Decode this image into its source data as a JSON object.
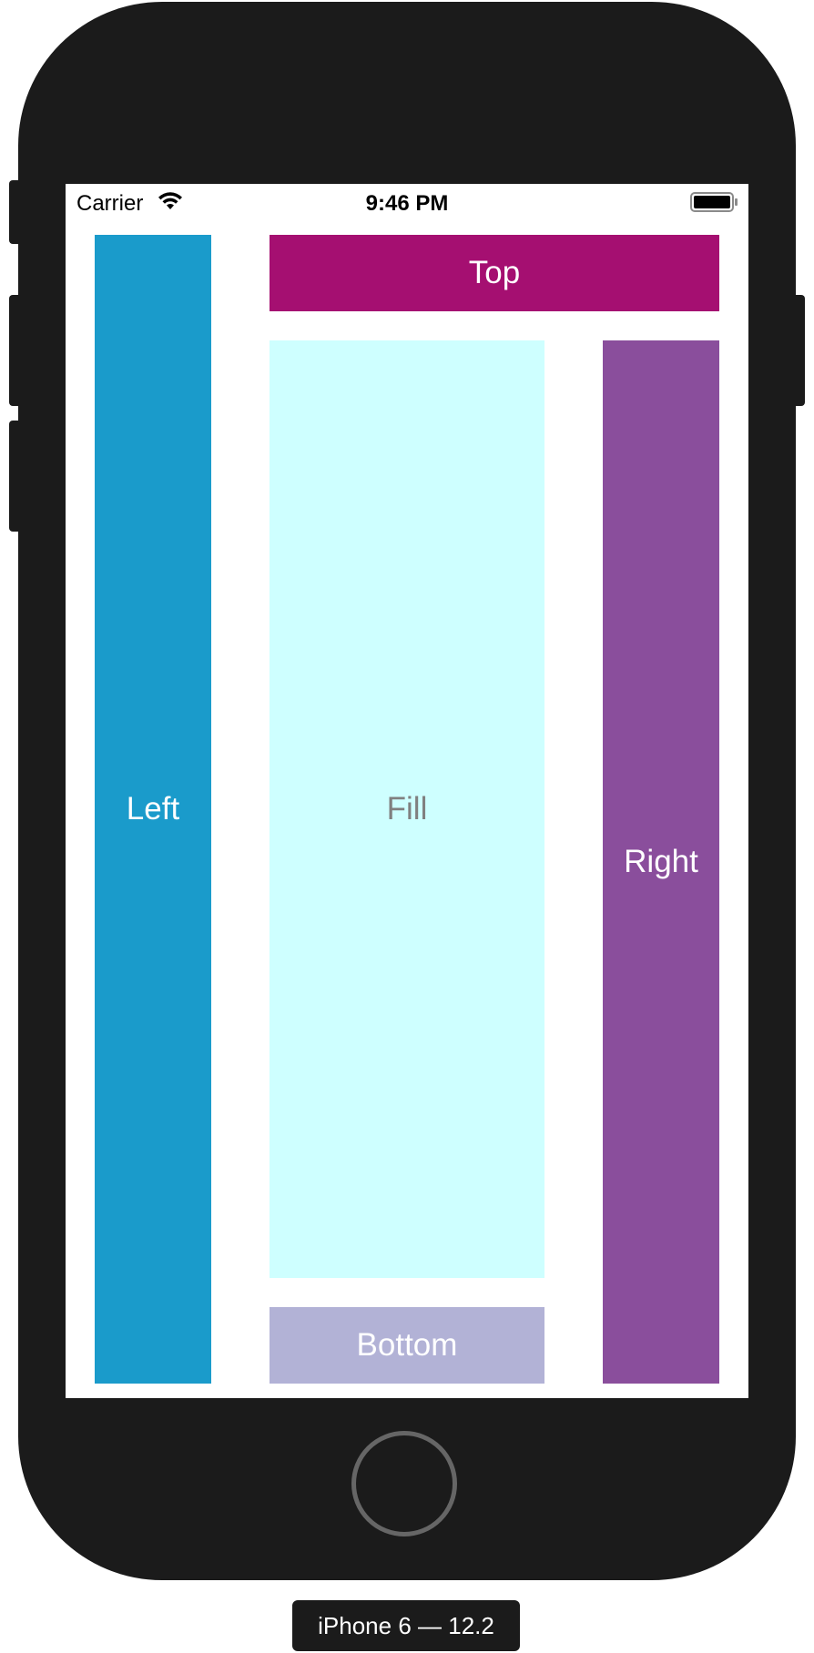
{
  "status_bar": {
    "carrier": "Carrier",
    "time": "9:46 PM",
    "wifi_icon": "wifi-icon",
    "battery_icon": "battery-icon"
  },
  "blocks": {
    "left": {
      "label": "Left",
      "color": "#1a9bcb",
      "text_color": "#ffffff"
    },
    "top": {
      "label": "Top",
      "color": "#a50f71",
      "text_color": "#ffffff"
    },
    "fill": {
      "label": "Fill",
      "color": "#ceffff",
      "text_color": "#808080"
    },
    "right": {
      "label": "Right",
      "color": "#8a4e9c",
      "text_color": "#ffffff"
    },
    "bottom": {
      "label": "Bottom",
      "color": "#b2b2d6",
      "text_color": "#ffffff"
    }
  },
  "device": {
    "label": "iPhone 6 — 12.2",
    "frame_color": "#1b1b1b"
  }
}
